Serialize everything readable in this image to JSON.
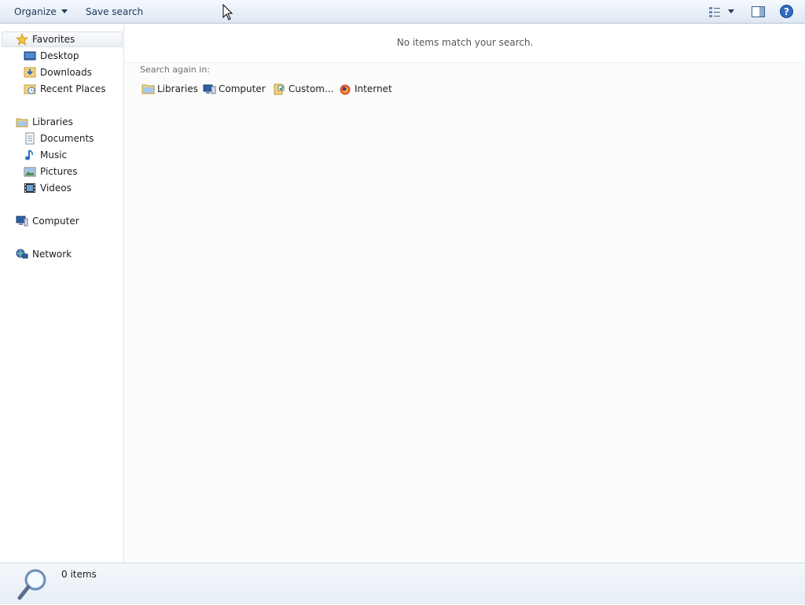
{
  "toolbar": {
    "organize_label": "Organize",
    "save_search_label": "Save search",
    "views_icon": "view-details-icon",
    "preview_pane_icon": "preview-pane-icon",
    "help_icon": "help-icon"
  },
  "nav": {
    "favorites": {
      "label": "Favorites",
      "items": [
        {
          "label": "Desktop",
          "icon": "desktop-icon"
        },
        {
          "label": "Downloads",
          "icon": "downloads-icon"
        },
        {
          "label": "Recent Places",
          "icon": "recent-places-icon"
        }
      ]
    },
    "libraries": {
      "label": "Libraries",
      "items": [
        {
          "label": "Documents",
          "icon": "documents-icon"
        },
        {
          "label": "Music",
          "icon": "music-icon"
        },
        {
          "label": "Pictures",
          "icon": "pictures-icon"
        },
        {
          "label": "Videos",
          "icon": "videos-icon"
        }
      ]
    },
    "computer": {
      "label": "Computer"
    },
    "network": {
      "label": "Network"
    }
  },
  "main": {
    "empty_message": "No items match your search.",
    "search_again_label": "Search again in:",
    "locations": [
      {
        "label": "Libraries",
        "icon": "libraries-icon"
      },
      {
        "label": "Computer",
        "icon": "computer-icon"
      },
      {
        "label": "Custom...",
        "icon": "custom-folder-icon"
      },
      {
        "label": "Internet",
        "icon": "internet-icon"
      }
    ]
  },
  "status": {
    "count_text": "0 items",
    "icon": "search-magnifier-icon"
  },
  "colors": {
    "toolbar_bg": "#e9f0f8",
    "text": "#1e395b",
    "nav_border": "#dde4ee"
  }
}
